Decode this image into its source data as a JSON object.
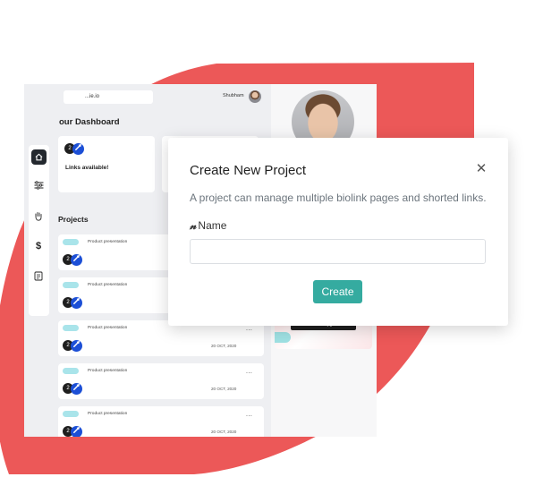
{
  "colors": {
    "blob": "#ec5858",
    "accent": "#35aba0",
    "badge_blue": "#1c4fd6",
    "pill": "#a9e4ea"
  },
  "topbar": {
    "search_value": "...ie.io",
    "username": "Shubham"
  },
  "sidebar": {
    "icons": [
      "home-icon",
      "sliders-icon",
      "hand-icon",
      "dollar-icon",
      "document-icon"
    ],
    "dollar_glyph": "$"
  },
  "dashboard": {
    "title": "our Dashboard",
    "cards": [
      {
        "text": "Links available!",
        "badge_count": "2"
      }
    ]
  },
  "projects": {
    "title": "Projects",
    "items": [
      {
        "name": "Product presentation",
        "badge_count": "2",
        "date": ""
      },
      {
        "name": "Product presentation",
        "badge_count": "2",
        "date": ""
      },
      {
        "name": "Product presentation",
        "badge_count": "2",
        "date": "20 OCT, 2020"
      },
      {
        "name": "Product presentation",
        "badge_count": "2",
        "date": "20 OCT, 2020"
      },
      {
        "name": "Product presentation",
        "badge_count": "2",
        "date": "20 OCT, 2020"
      }
    ],
    "menu_glyph": "..."
  },
  "right_panel": {
    "upgrade_label": "Rename Upgrade"
  },
  "modal": {
    "title": "Create New Project",
    "close_glyph": "✕",
    "description": "A project can manage multiple biolink pages and shorted links.",
    "name_icon_glyph": "𝓃",
    "name_label": "Name",
    "name_value": "",
    "name_placeholder": "",
    "create_label": "Create"
  }
}
